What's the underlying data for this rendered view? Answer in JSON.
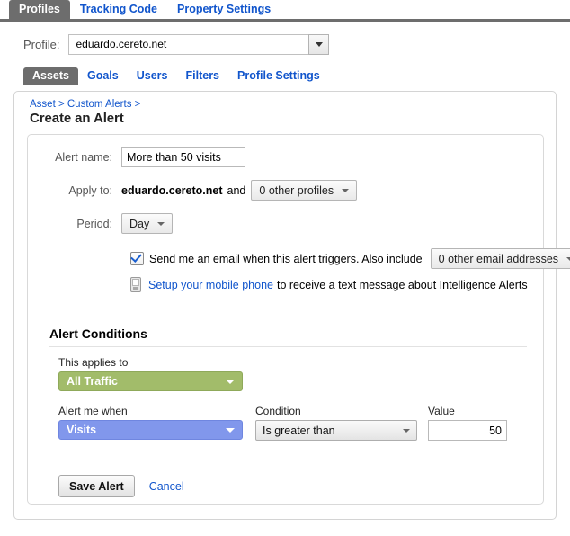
{
  "top_tabs": [
    {
      "label": "Profiles",
      "active": true
    },
    {
      "label": "Tracking Code",
      "active": false
    },
    {
      "label": "Property Settings",
      "active": false
    }
  ],
  "profile_selector": {
    "label": "Profile:",
    "value": "eduardo.cereto.net",
    "arrow_icon": "chevron-down-icon"
  },
  "sub_tabs": [
    {
      "label": "Assets",
      "active": true
    },
    {
      "label": "Goals",
      "active": false
    },
    {
      "label": "Users",
      "active": false
    },
    {
      "label": "Filters",
      "active": false
    },
    {
      "label": "Profile Settings",
      "active": false
    }
  ],
  "panel": {
    "breadcrumb": "Asset > Custom Alerts >",
    "title": "Create an Alert"
  },
  "form": {
    "alert_name": {
      "label": "Alert name:",
      "value": "More than 50 visits"
    },
    "apply_to": {
      "label": "Apply to:",
      "profile": "eduardo.cereto.net",
      "conjunction": "and",
      "other_profiles": "0 other profiles"
    },
    "period": {
      "label": "Period:",
      "value": "Day"
    },
    "email": {
      "checked": true,
      "text": "Send me an email when this alert triggers. Also include",
      "other_addresses": "0 other email addresses"
    },
    "mobile": {
      "icon": "mobile-phone-icon",
      "link": "Setup your mobile phone",
      "rest": "to receive a text message about Intelligence Alerts"
    }
  },
  "conditions": {
    "heading": "Alert Conditions",
    "applies_to": {
      "label": "This applies to",
      "value": "All Traffic",
      "color": "#a2bc6a"
    },
    "alert_when": {
      "label": "Alert me when",
      "value": "Visits",
      "color": "#8197ec"
    },
    "condition": {
      "label": "Condition",
      "value": "Is greater than"
    },
    "value": {
      "label": "Value",
      "value": "50"
    }
  },
  "footer": {
    "save_label": "Save Alert",
    "cancel_label": "Cancel"
  }
}
